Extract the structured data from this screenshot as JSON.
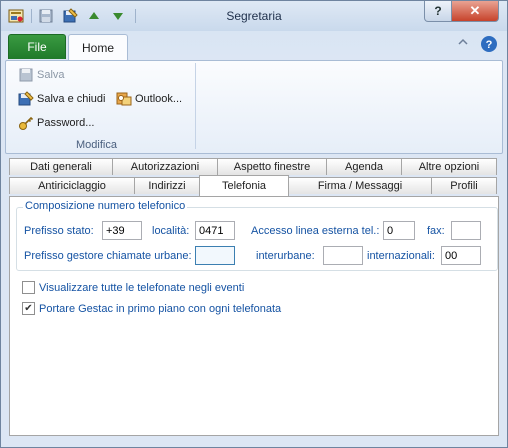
{
  "window": {
    "title": "Segretaria",
    "help_glyph": "?",
    "close_glyph": "✕"
  },
  "ribbon": {
    "file_tab": "File",
    "home_tab": "Home",
    "buttons": {
      "salva": "Salva",
      "salva_chiudi": "Salva e chiudi",
      "outlook": "Outlook...",
      "password": "Password..."
    },
    "group_label": "Modifica"
  },
  "tabs": {
    "row1": [
      "Dati generali",
      "Autorizzazioni",
      "Aspetto finestre",
      "Agenda",
      "Altre opzioni"
    ],
    "row2": [
      "Antiriciclaggio",
      "Indirizzi",
      "Telefonia",
      "Firma / Messaggi",
      "Profili"
    ],
    "active": "Telefonia"
  },
  "telefonia": {
    "group_title": "Composizione numero telefonico",
    "prefisso_stato_label": "Prefisso stato:",
    "prefisso_stato_value": "+39",
    "localita_label": "località:",
    "localita_value": "0471",
    "accesso_linea_label": "Accesso linea esterna tel.:",
    "accesso_linea_value": "0",
    "fax_label": "fax:",
    "fax_value": "",
    "prefisso_gestore_label": "Prefisso gestore chiamate urbane:",
    "prefisso_gestore_value": "",
    "interurbane_label": "interurbane:",
    "interurbane_value": "",
    "internazionali_label": "internazionali:",
    "internazionali_value": "00",
    "check_visualizzare": {
      "label": "Visualizzare tutte le telefonate negli eventi",
      "checked": false
    },
    "check_primo_piano": {
      "label": "Portare Gestac in primo piano con ogni telefonata",
      "checked": true
    }
  },
  "colors": {
    "label_blue": "#1553a3",
    "file_green": "#2a8a34"
  }
}
